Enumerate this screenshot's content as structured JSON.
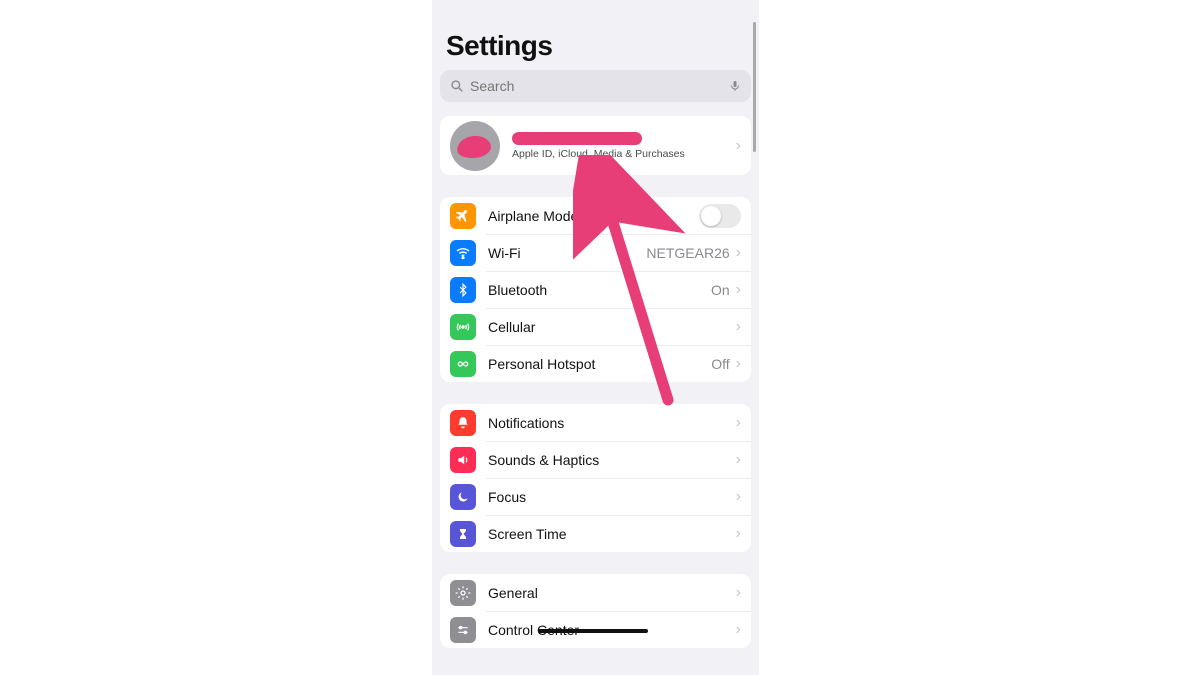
{
  "title": "Settings",
  "search": {
    "placeholder": "Search"
  },
  "profile": {
    "name_redacted": true,
    "subtitle": "Apple ID, iCloud, Media & Purchases"
  },
  "groups": [
    {
      "id": "connectivity",
      "rows": [
        {
          "id": "airplane",
          "icon": "airplane-icon",
          "icon_bg": "#ff9500",
          "label": "Airplane Mode",
          "control": "toggle",
          "toggle_on": false
        },
        {
          "id": "wifi",
          "icon": "wifi-icon",
          "icon_bg": "#0a7aff",
          "label": "Wi-Fi",
          "value": "NETGEAR26",
          "control": "chevron"
        },
        {
          "id": "bluetooth",
          "icon": "bluetooth-icon",
          "icon_bg": "#0a7aff",
          "label": "Bluetooth",
          "value": "On",
          "control": "chevron"
        },
        {
          "id": "cellular",
          "icon": "cellular-icon",
          "icon_bg": "#34c759",
          "label": "Cellular",
          "control": "chevron"
        },
        {
          "id": "hotspot",
          "icon": "hotspot-icon",
          "icon_bg": "#34c759",
          "label": "Personal Hotspot",
          "value": "Off",
          "control": "chevron"
        }
      ]
    },
    {
      "id": "notifications",
      "rows": [
        {
          "id": "notifications",
          "icon": "bell-icon",
          "icon_bg": "#ff3b30",
          "label": "Notifications",
          "control": "chevron"
        },
        {
          "id": "sounds",
          "icon": "speaker-icon",
          "icon_bg": "#ff2d55",
          "label": "Sounds & Haptics",
          "control": "chevron"
        },
        {
          "id": "focus",
          "icon": "moon-icon",
          "icon_bg": "#5856d6",
          "label": "Focus",
          "control": "chevron"
        },
        {
          "id": "screentime",
          "icon": "hourglass-icon",
          "icon_bg": "#5856d6",
          "label": "Screen Time",
          "control": "chevron"
        }
      ]
    },
    {
      "id": "system",
      "rows": [
        {
          "id": "general",
          "icon": "gear-icon",
          "icon_bg": "#8e8e93",
          "label": "General",
          "control": "chevron"
        },
        {
          "id": "control",
          "icon": "sliders-icon",
          "icon_bg": "#8e8e93",
          "label": "Control Center",
          "control": "chevron",
          "scribbled": true
        }
      ]
    }
  ],
  "annotation": {
    "arrow_color": "#e83e77",
    "points_to": "profile-row"
  }
}
